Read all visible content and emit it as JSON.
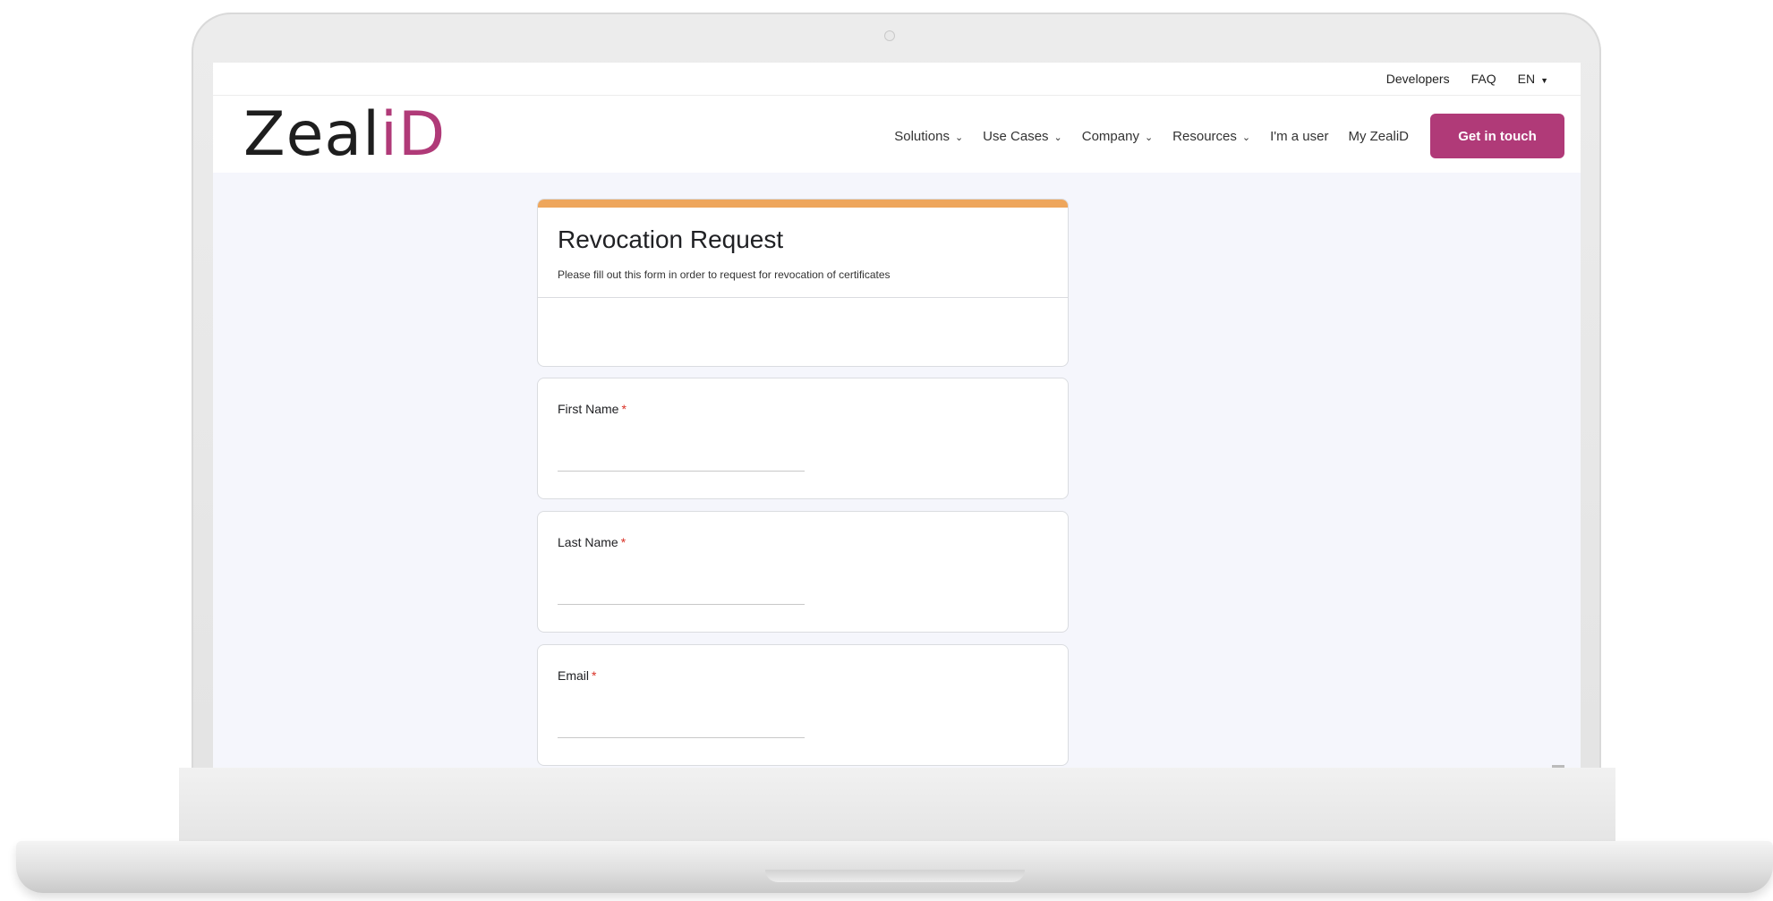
{
  "topbar": {
    "links": [
      "Developers",
      "FAQ"
    ],
    "language": "EN"
  },
  "brand": {
    "logo_main": "Zeal",
    "logo_accent": "iD",
    "accent_color": "#b03a78"
  },
  "nav": {
    "items": [
      {
        "label": "Solutions",
        "dropdown": true
      },
      {
        "label": "Use Cases",
        "dropdown": true
      },
      {
        "label": "Company",
        "dropdown": true
      },
      {
        "label": "Resources",
        "dropdown": true
      },
      {
        "label": "I'm a user",
        "dropdown": false
      },
      {
        "label": "My ZealiD",
        "dropdown": false
      }
    ],
    "cta_label": "Get in touch"
  },
  "form": {
    "title": "Revocation Request",
    "description": "Please fill out this form in order to request for revocation of certificates",
    "header_color": "#eea65c",
    "required_mark": "*",
    "fields": [
      {
        "label": "First Name",
        "value": ""
      },
      {
        "label": "Last Name",
        "value": ""
      },
      {
        "label": "Email",
        "value": ""
      }
    ]
  }
}
